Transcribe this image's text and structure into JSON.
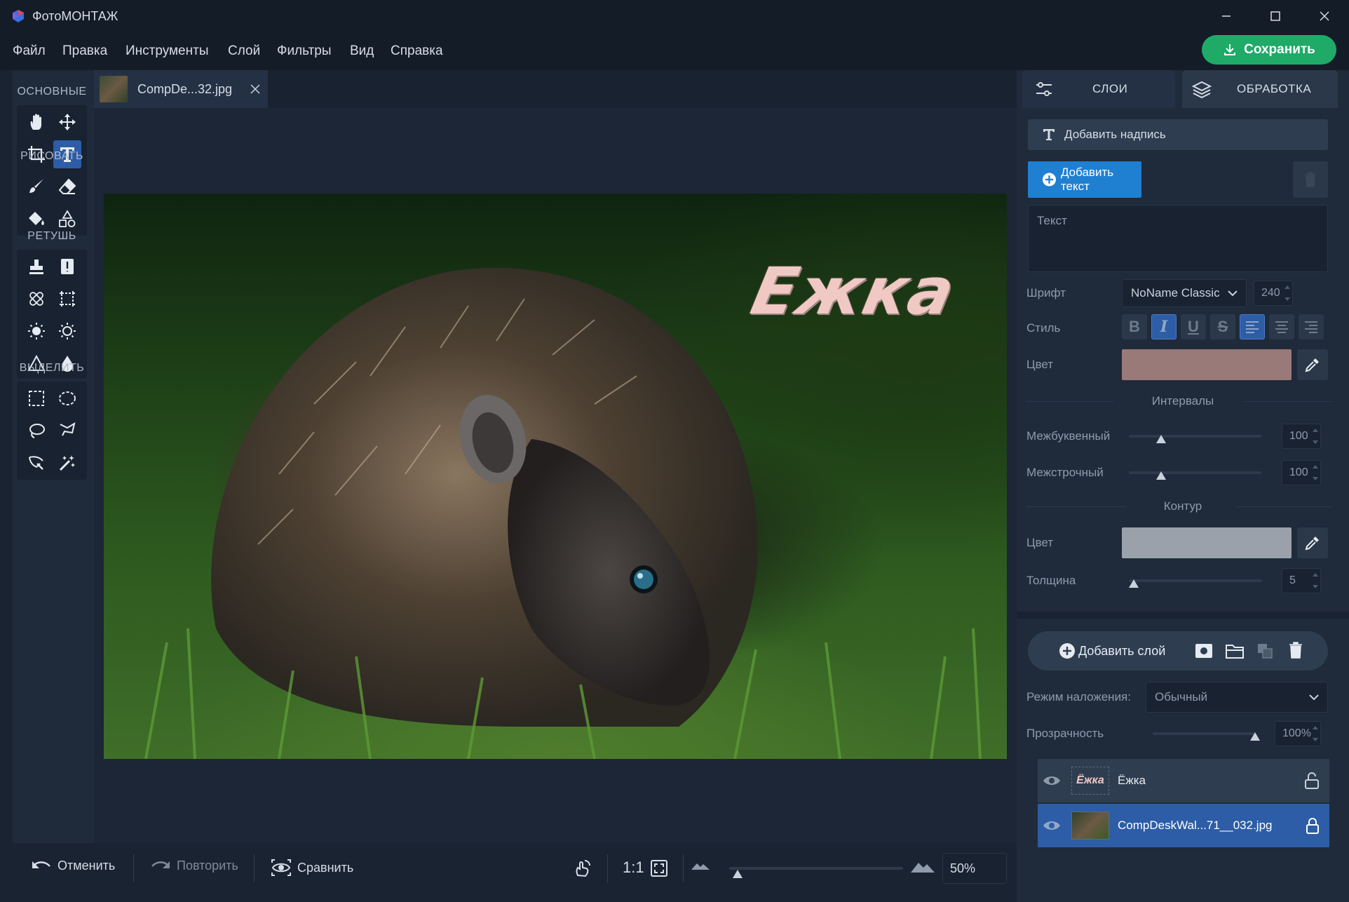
{
  "app": {
    "title": "ФотоМОНТАЖ"
  },
  "menu": {
    "items": [
      "Файл",
      "Правка",
      "Инструменты",
      "Слой",
      "Фильтры",
      "Вид",
      "Справка"
    ],
    "save_label": "Сохранить"
  },
  "tools": {
    "categories": [
      "ОСНОВНЫЕ",
      "РИСОВАТЬ",
      "РЕТУШЬ",
      "ВЫДЕЛИТЬ"
    ]
  },
  "document": {
    "tab_label": "CompDe...32.jpg",
    "overlay_text": "Ежка"
  },
  "bottom": {
    "undo": "Отменить",
    "redo": "Повторить",
    "compare": "Сравнить",
    "one_to_one": "1:1",
    "zoom": "50%"
  },
  "panel": {
    "tabs": [
      "СЛОИ",
      "ОБРАБОТКА"
    ],
    "add_caption": "Добавить надпись",
    "add_text": "Добавить текст",
    "text_placeholder": "Текст",
    "font_label": "Шрифт",
    "font_value": "NoName Classic",
    "font_size": "240",
    "style_label": "Стиль",
    "color_label": "Цвет",
    "text_color": "#9a7a78",
    "intervals_title": "Интервалы",
    "letter_spacing_label": "Межбуквенный",
    "letter_spacing": "100",
    "line_spacing_label": "Межстрочный",
    "line_spacing": "100",
    "outline_title": "Контур",
    "outline_color_label": "Цвет",
    "outline_color": "#9aa1ab",
    "thickness_label": "Толщина",
    "thickness": "5",
    "add_layer": "Добавить слой",
    "blend_label": "Режим наложения:",
    "blend_value": "Обычный",
    "opacity_label": "Прозрачность",
    "opacity": "100%",
    "layers": [
      {
        "name": "Ёжка",
        "thumb_text": "Ёжка"
      },
      {
        "name": "CompDeskWal...71__032.jpg"
      }
    ]
  },
  "colors": {
    "accent": "#2c5da6",
    "save_green": "#1faa68",
    "add_text_blue": "#1f7fd1"
  }
}
